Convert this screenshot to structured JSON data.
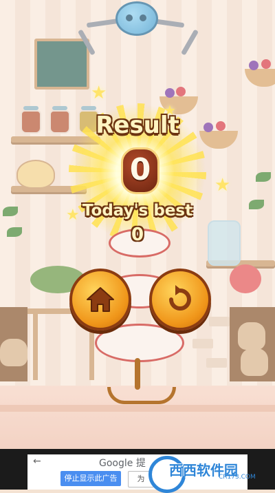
{
  "result": {
    "title": "Result",
    "score": "0",
    "best_label": "Today's best",
    "best_value": "0"
  },
  "buttons": {
    "home_icon": "home-icon",
    "retry_icon": "retry-icon"
  },
  "ad": {
    "back_arrow": "←",
    "brand": "Google 提",
    "stop_label": "停止显示此广告",
    "why_label": "为"
  },
  "watermark": {
    "text": "西西软件园",
    "url": "CR173.COM"
  },
  "colors": {
    "title_fill": "#fff4c2",
    "title_outline": "#6b3310",
    "button_orange": "#f0961a",
    "ad_stop_blue": "#4a8ef0"
  }
}
